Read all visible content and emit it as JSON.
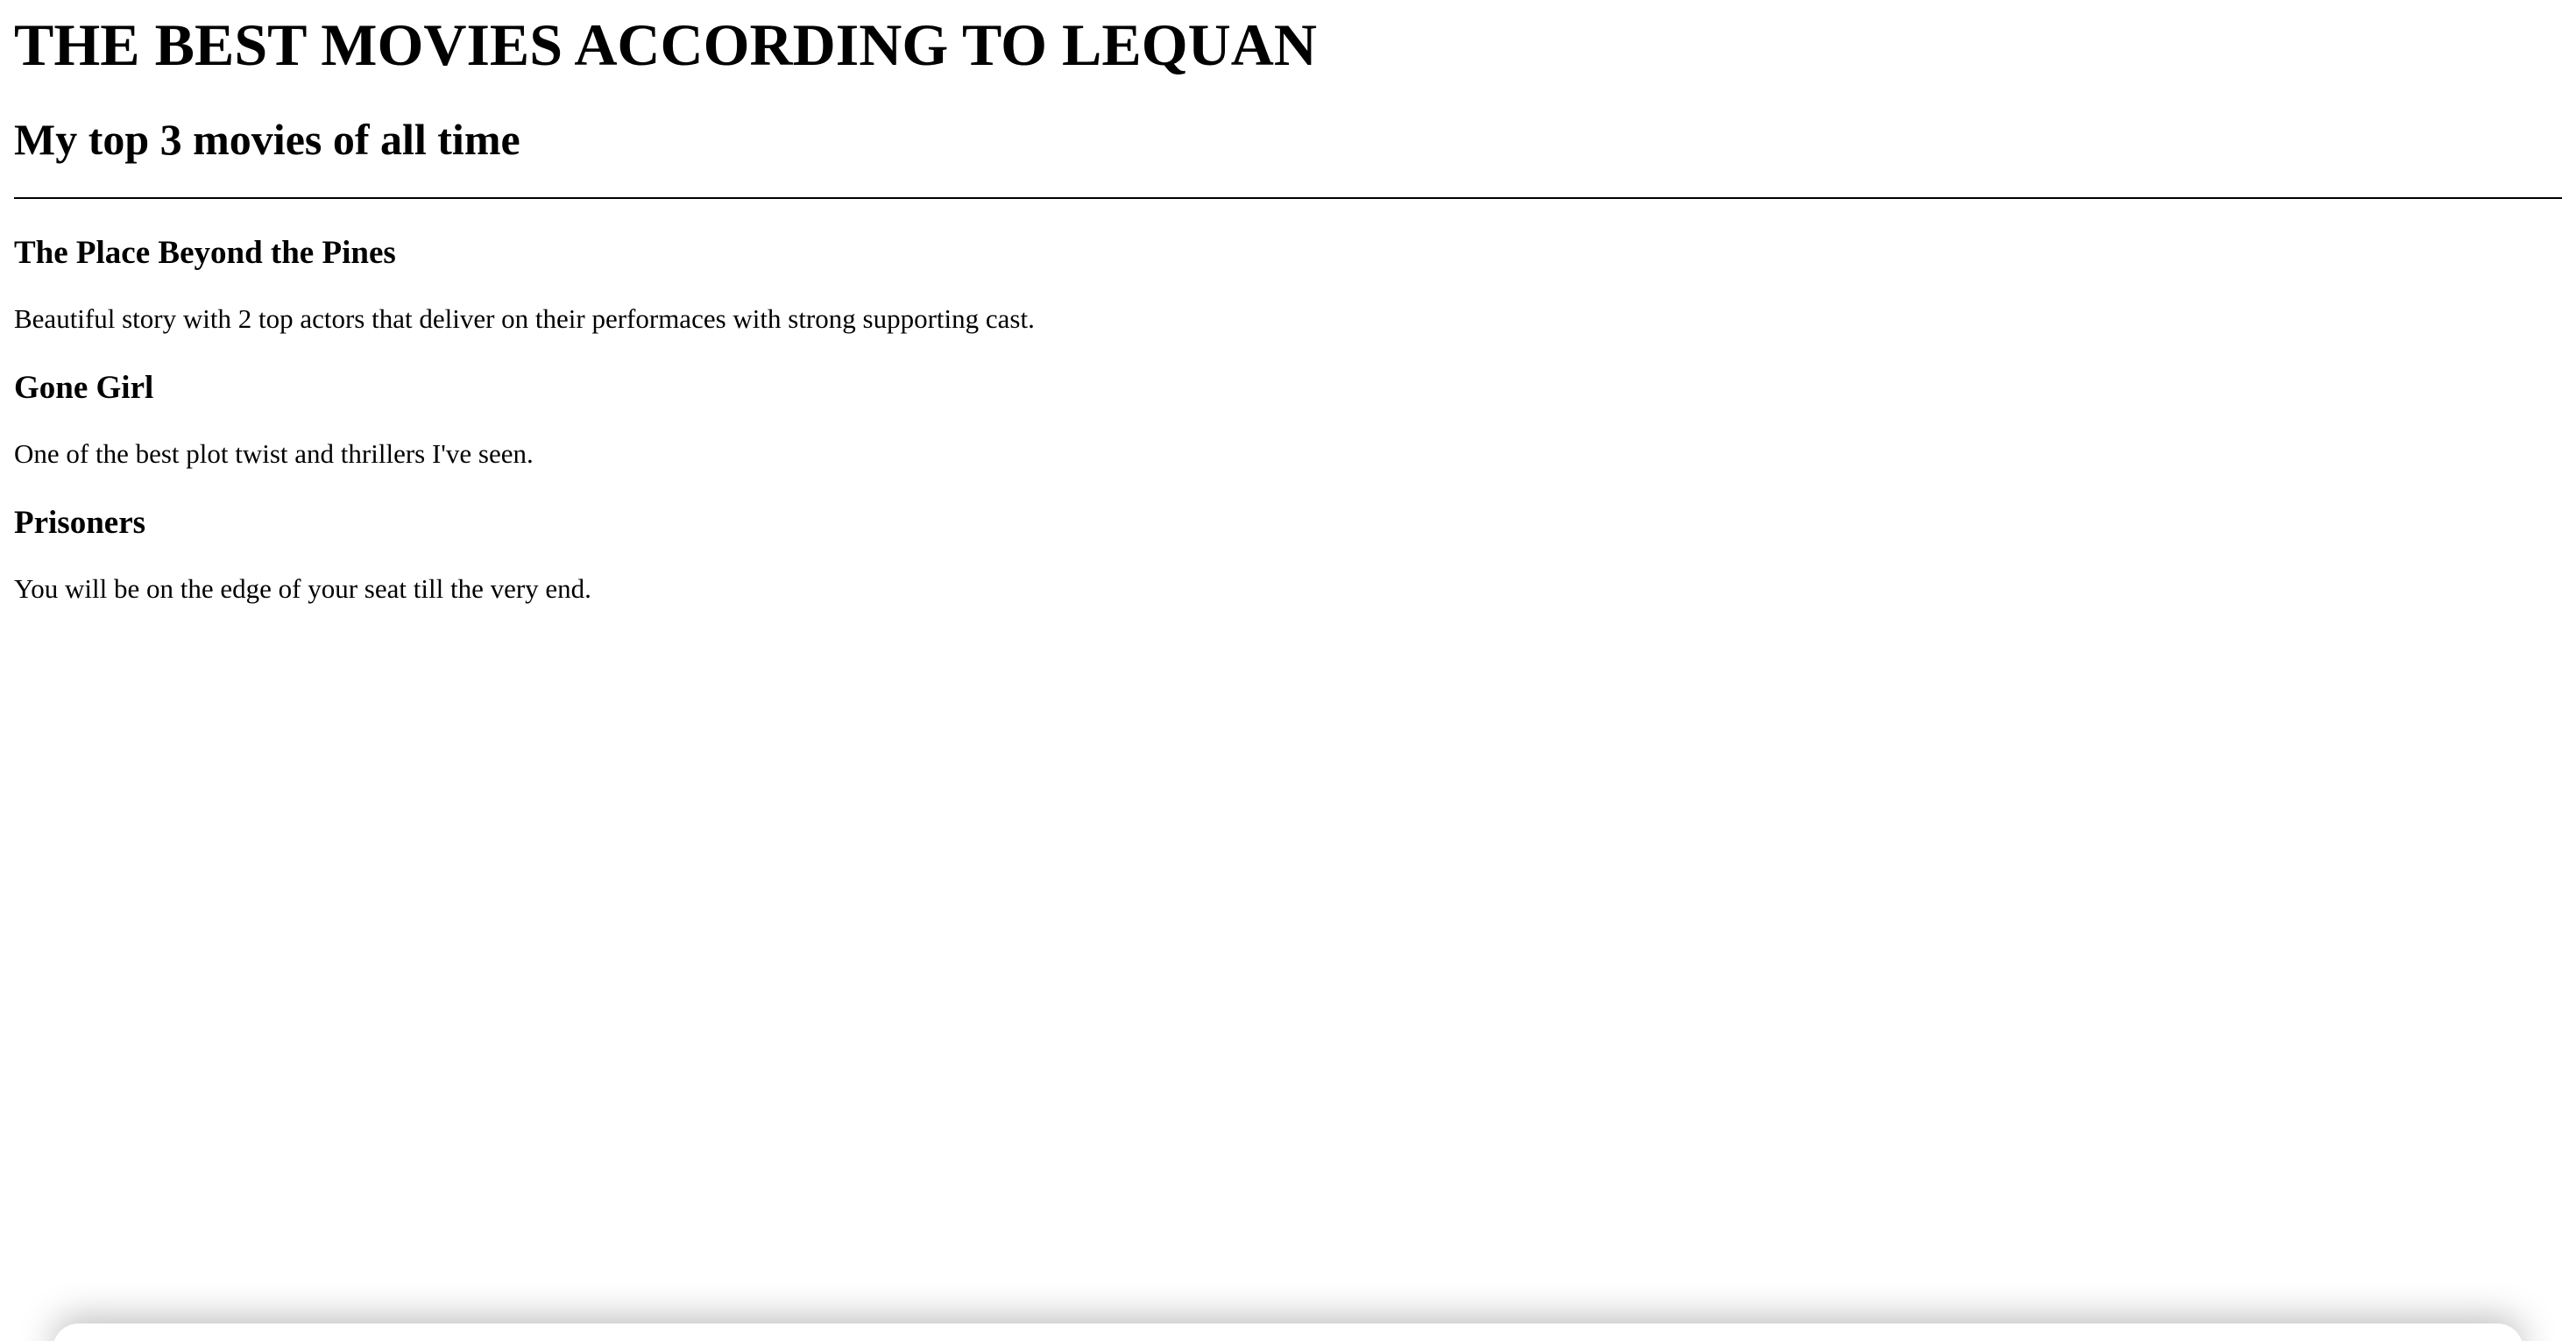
{
  "page": {
    "title": "THE BEST MOVIES ACCORDING TO LEQUAN",
    "subtitle": "My top 3 movies of all time"
  },
  "movies": [
    {
      "title": "The Place Beyond the Pines",
      "description": "Beautiful story with 2 top actors that deliver on their performaces with strong supporting cast."
    },
    {
      "title": "Gone Girl",
      "description": "One of the best plot twist and thrillers I've seen."
    },
    {
      "title": "Prisoners",
      "description": "You will be on the edge of your seat till the very end."
    }
  ]
}
